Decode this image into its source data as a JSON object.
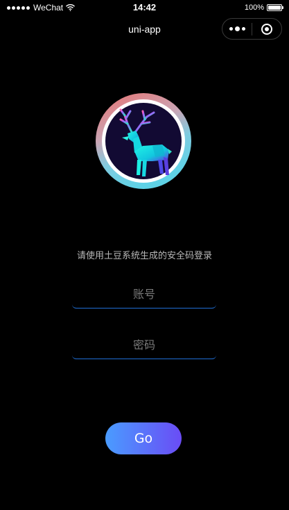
{
  "status_bar": {
    "carrier": "WeChat",
    "time": "14:42",
    "battery_text": "100%",
    "battery_level": 1.0
  },
  "nav": {
    "title": "uni-app"
  },
  "logo": {
    "icon": "deer-logo-icon",
    "ring_colors": [
      "#e8716f",
      "#5fd2e6"
    ],
    "deer_color": "#11e7e0"
  },
  "login": {
    "prompt": "请使用土豆系统生成的安全码登录",
    "account_placeholder": "账号",
    "account_value": "",
    "password_placeholder": "密码",
    "password_value": "",
    "go_label": "Go"
  },
  "colors": {
    "background": "#000000",
    "field_underline": "#1f6fd6",
    "button_gradient": [
      "#4a9cff",
      "#6a4cf5"
    ]
  }
}
